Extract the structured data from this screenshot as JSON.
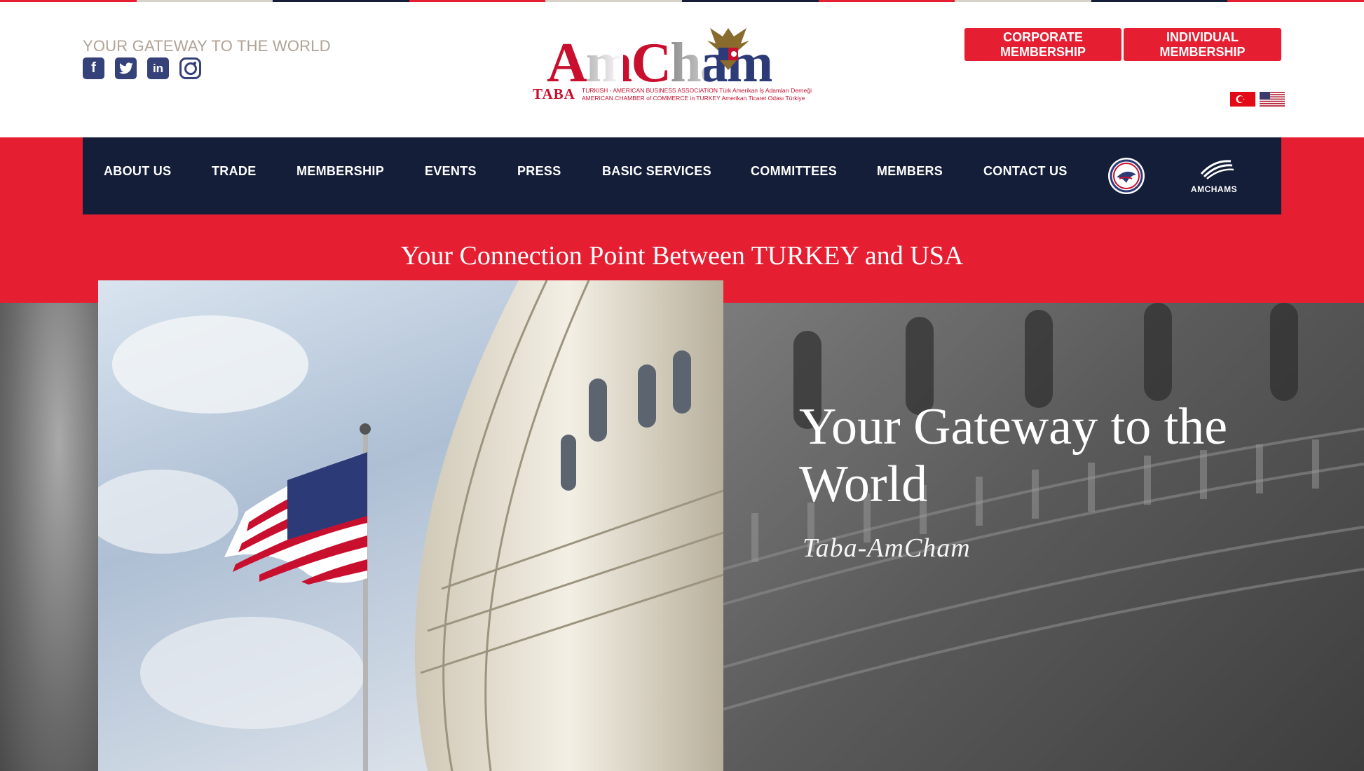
{
  "header": {
    "tagline": "YOUR GATEWAY TO THE WORLD",
    "social_icons": [
      "facebook-icon",
      "twitter-icon",
      "linkedin-icon",
      "instagram-icon"
    ],
    "logo": {
      "main": "AmCham",
      "taba": "TABA",
      "sub1": "TURKISH - AMERICAN BUSINESS ASSOCIATION Türk Amerikan İş Adamları Derneği",
      "sub2": "AMERICAN CHAMBER of COMMERCE in TURKEY Amerikan Ticaret Odası Türkiye"
    },
    "corporate_membership": "CORPORATE MEMBERSHIP",
    "individual_membership": "INDIVIDUAL MEMBERSHIP",
    "languages": [
      "turkish-flag-icon",
      "us-flag-icon"
    ]
  },
  "nav": {
    "items": [
      "ABOUT US",
      "TRADE",
      "MEMBERSHIP",
      "EVENTS",
      "PRESS",
      "BASIC SERVICES",
      "COMMITTEES",
      "MEMBERS",
      "CONTACT US"
    ],
    "extra_icons": [
      "us-chamber-seal-icon",
      "amchams-in-europe-logo"
    ],
    "amchams_label": "AMCHAMS"
  },
  "banner": {
    "headline": "Your Connection Point Between TURKEY and USA"
  },
  "hero": {
    "title": "Your Gateway to the World",
    "signature": "Taba-AmCham"
  },
  "colors": {
    "brand_red": "#e61e31",
    "nav_navy": "#141e38",
    "tagline_tan": "#b0a295",
    "social_blue": "#35427a"
  }
}
